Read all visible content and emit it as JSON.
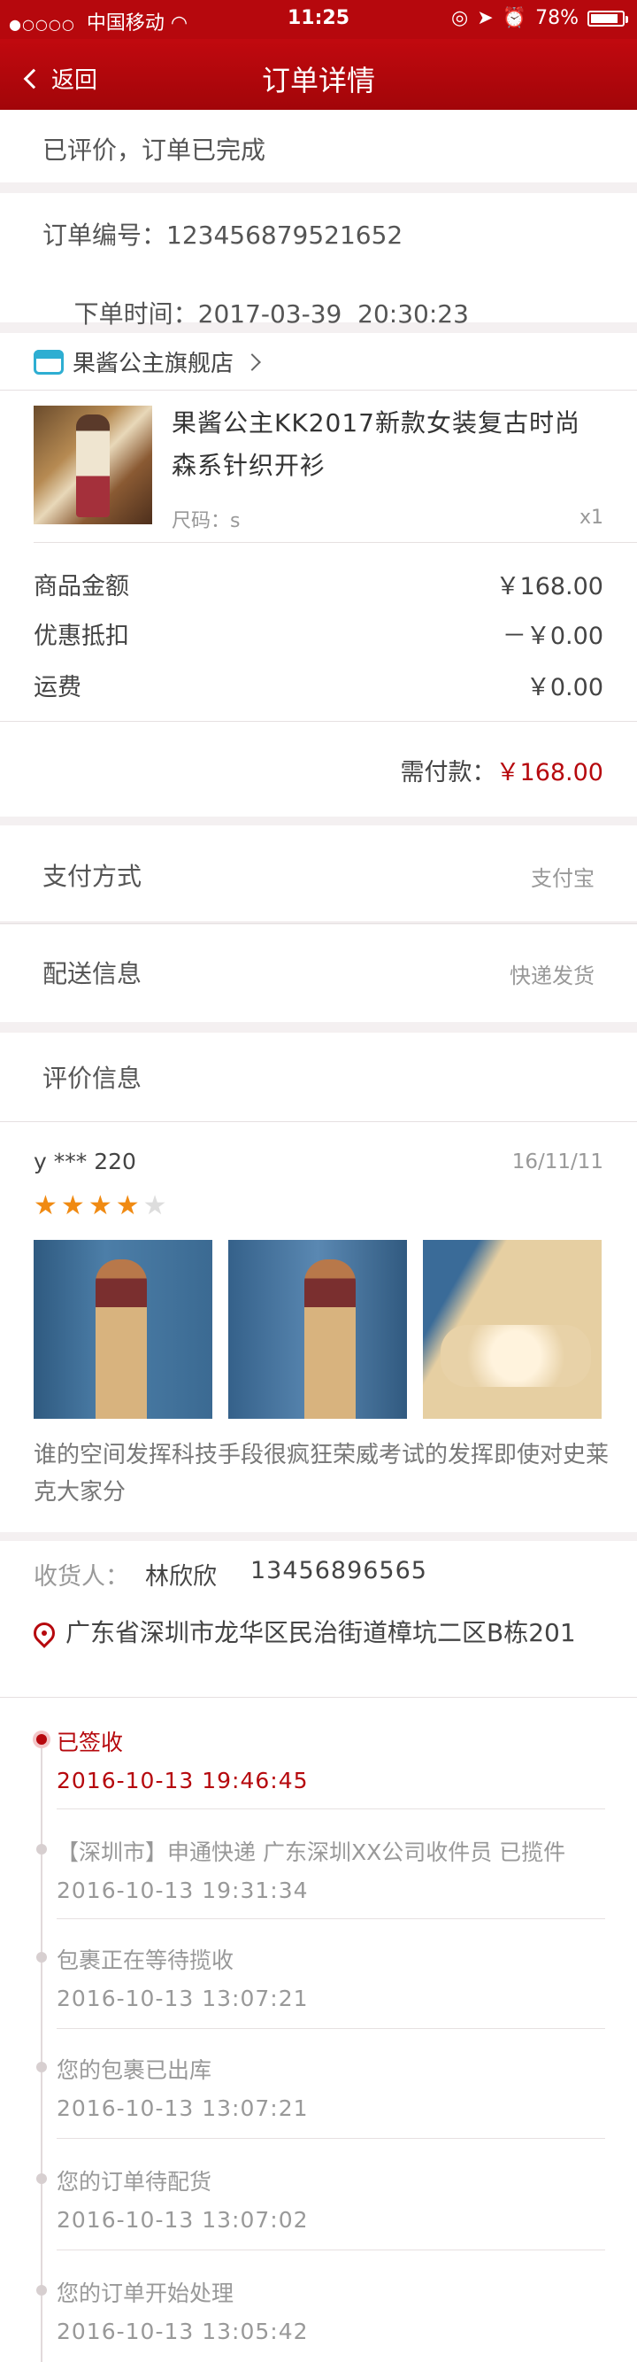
{
  "status_bar": {
    "carrier": "中国移动",
    "time": "11:25",
    "battery": "78%",
    "battery_level": 0.78
  },
  "nav": {
    "back_label": "返回",
    "title": "订单详情"
  },
  "order": {
    "status": "已评价，订单已完成",
    "number_label": "订单编号：",
    "number": "123456879521652",
    "time_label": "下单时间：",
    "time": "2017-03-39  20:30:23"
  },
  "shop": {
    "name": "果酱公主旗舰店"
  },
  "product": {
    "title": "果酱公主KK2017新款女装复古时尚森系针织开衫",
    "size_label": "尺码：",
    "size": "s",
    "qty": "x1"
  },
  "amounts": {
    "goods_label": "商品金额",
    "goods_value": "￥168.00",
    "discount_label": "优惠抵扣",
    "discount_value": "－￥0.00",
    "shipping_label": "运费",
    "shipping_value": "￥0.00",
    "due_label": "需付款：",
    "due_value": "￥168.00"
  },
  "payment": {
    "label": "支付方式",
    "value": "支付宝"
  },
  "delivery": {
    "label": "配送信息",
    "value": "快递发货"
  },
  "review": {
    "section_title": "评价信息",
    "user": "y *** 220",
    "date": "16/11/11",
    "rating": 4,
    "max_rating": 5,
    "text": "谁的空间发挥科技手段很疯狂荣威考试的发挥即使对史莱克大家分"
  },
  "recipient": {
    "label": "收货人：",
    "name": "林欣欣",
    "phone": "13456896565",
    "address": "广东省深圳市龙华区民治街道樟坑二区B栋201"
  },
  "tracking": [
    {
      "text": "已签收",
      "time": "2016-10-13 19:46:45",
      "active": true
    },
    {
      "text": "【深圳市】申通快递 广东深圳XX公司收件员 已揽件",
      "time": "2016-10-13 19:31:34",
      "active": false
    },
    {
      "text": "包裹正在等待揽收",
      "time": "2016-10-13 13:07:21",
      "active": false
    },
    {
      "text": "您的包裹已出库",
      "time": "2016-10-13 13:07:21",
      "active": false
    },
    {
      "text": "您的订单待配货",
      "time": "2016-10-13 13:07:02",
      "active": false
    },
    {
      "text": "您的订单开始处理",
      "time": "2016-10-13 13:05:42",
      "active": false
    }
  ]
}
